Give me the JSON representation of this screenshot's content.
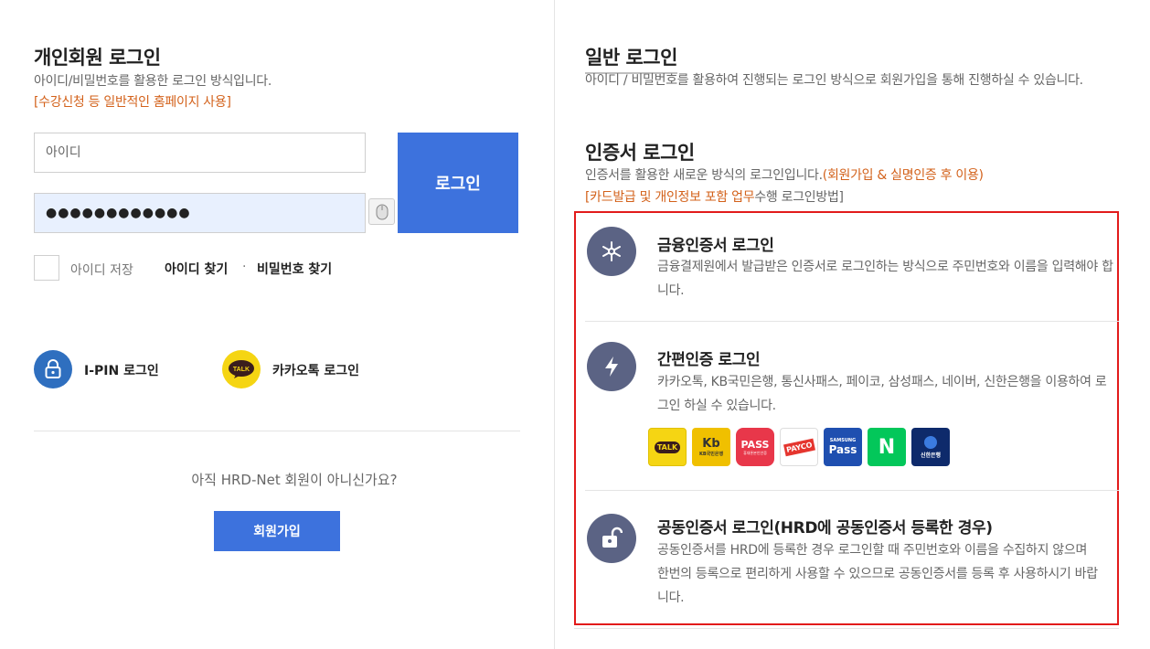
{
  "personal": {
    "title": "개인회원 로그인",
    "desc": "아이디/비밀번호를 활용한 로그인 방식입니다.",
    "note": "[수강신청 등 일반적인 홈페이지 사용]",
    "id_placeholder": "아이디",
    "pw_value": "●●●●●●●●●●●●",
    "login_label": "로그인",
    "save_id_label": "아이디 저장",
    "find_id_label": "아이디 찾기",
    "separator": "·",
    "find_pw_label": "비밀번호 찾기",
    "ipin_label": "I-PIN 로그인",
    "kakao_label": "카카오톡 로그인",
    "kakao_badge": "TALK",
    "ask": "아직 HRD-Net 회원이 아니신가요?",
    "join_label": "회원가입"
  },
  "general": {
    "title": "일반 로그인",
    "desc": "아이디 / 비밀번호를 활용하여 진행되는 로그인 방식으로 회원가입을 통해 진행하실 수 있습니다."
  },
  "cert": {
    "title": "인증서 로그인",
    "desc_main": "인증서를 활용한 새로운 방식의 로그인입니다.",
    "desc_orange": "(회원가입 & 실명인증 후 이용)",
    "desc2_orange": "[카드발급 및 개인정보 포함 업무",
    "desc2_rest": "수행 로그인방법]",
    "cards": [
      {
        "title": "금융인증서 로그인",
        "desc": "금융결제원에서 발급받은 인증서로 로그인하는 방식으로 주민번호와 이름을 입력해야 합니다."
      },
      {
        "title": "간편인증 로그인",
        "desc": "카카오톡, KB국민은행, 통신사패스, 페이코, 삼성패스, 네이버, 신한은행을 이용하여 로그인 하실 수 있습니다.",
        "chips": [
          "TALK",
          "KB국민은행",
          "PASS",
          "PAYCO",
          "Pass",
          "N",
          "신한은행"
        ],
        "chip_subs": [
          "",
          "",
          "휴대폰본인인증",
          "",
          "SAMSUNG",
          "",
          ""
        ]
      },
      {
        "title": "공동인증서 로그인(HRD에 공동인증서 등록한 경우)",
        "desc": "공동인증서를 HRD에 등록한 경우 로그인할 때 주민번호와 이름을 수집하지 않으며 한번의 등록으로 편리하게 사용할 수 있으므로 공동인증서를 등록 후 사용하시기 바랍니다."
      }
    ]
  },
  "colors": {
    "primary": "#3d72dd",
    "accent_orange": "#d3611a",
    "highlight_border": "#e21b1b",
    "icon_bg": "#5b6384",
    "kakao_yellow": "#f5d513"
  }
}
